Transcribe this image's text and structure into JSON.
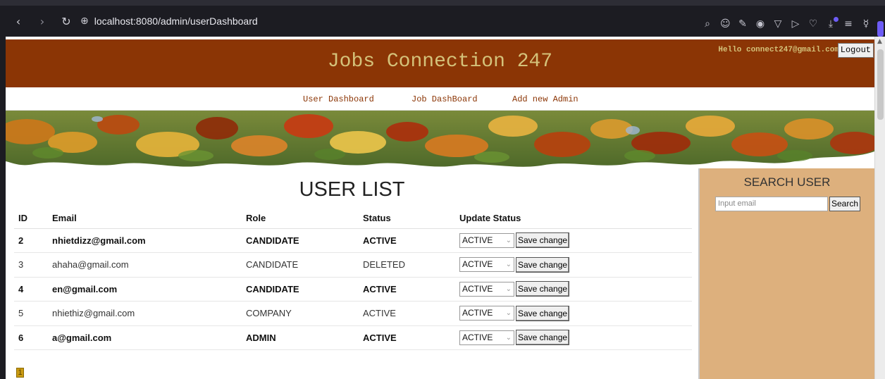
{
  "browser": {
    "url": "localhost:8080/admin/userDashboard",
    "icons": [
      "back-icon",
      "forward-icon",
      "reload-icon",
      "site-info-icon",
      "zoom-icon",
      "emoji-icon",
      "edit-icon",
      "camera-icon",
      "shield-icon",
      "play-icon",
      "heart-icon",
      "download-icon",
      "menu-icon",
      "profile-icon"
    ]
  },
  "header": {
    "title": "Jobs Connection 247",
    "greeting": "Hello connect247@gmail.com",
    "logout_label": "Logout"
  },
  "nav": {
    "items": [
      {
        "label": "User Dashboard"
      },
      {
        "label": "Job DashBoard"
      },
      {
        "label": "Add new Admin"
      }
    ]
  },
  "user_list": {
    "title": "USER LIST",
    "columns": [
      "ID",
      "Email",
      "Role",
      "Status",
      "Update Status"
    ],
    "rows": [
      {
        "id": "2",
        "email": "nhietdizz@gmail.com",
        "role": "CANDIDATE",
        "status": "ACTIVE",
        "selected": "ACTIVE",
        "save_label": "Save change",
        "bold": true
      },
      {
        "id": "3",
        "email": "ahaha@gmail.com",
        "role": "CANDIDATE",
        "status": "DELETED",
        "selected": "ACTIVE",
        "save_label": "Save change",
        "bold": false
      },
      {
        "id": "4",
        "email": "en@gmail.com",
        "role": "CANDIDATE",
        "status": "ACTIVE",
        "selected": "ACTIVE",
        "save_label": "Save change",
        "bold": true
      },
      {
        "id": "5",
        "email": "nhiethiz@gmail.com",
        "role": "COMPANY",
        "status": "ACTIVE",
        "selected": "ACTIVE",
        "save_label": "Save change",
        "bold": false
      },
      {
        "id": "6",
        "email": "a@gmail.com",
        "role": "ADMIN",
        "status": "ACTIVE",
        "selected": "ACTIVE",
        "save_label": "Save change",
        "bold": true
      }
    ],
    "page": "1"
  },
  "search": {
    "title": "SEARCH USER",
    "placeholder": "Input email",
    "button_label": "Search"
  },
  "colors": {
    "header_bg": "#8b3505",
    "title_text": "#d4c27a",
    "sidebar_bg": "#ddb07d",
    "nav_link": "#8b3505"
  }
}
